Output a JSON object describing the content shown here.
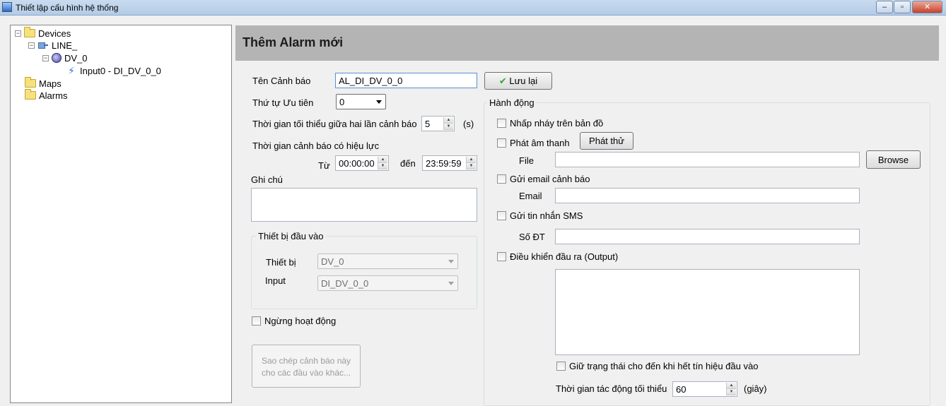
{
  "window": {
    "title": "Thiết lập cấu hình hệ thống",
    "minimize_glyph": "–",
    "maximize_glyph": "▫",
    "close_glyph": "✕"
  },
  "tree": {
    "devices": "Devices",
    "line": "LINE_",
    "device": "DV_0",
    "input": "Input0 - DI_DV_0_0",
    "maps": "Maps",
    "alarms": "Alarms",
    "expander_minus": "−"
  },
  "header": {
    "title": "Thêm Alarm mới"
  },
  "form": {
    "alarm_name_label": "Tên Cảnh báo",
    "alarm_name_value": "AL_DI_DV_0_0",
    "save_button": "Lưu lại",
    "priority_label": "Thứ tự Ưu tiên",
    "priority_value": "0",
    "min_interval_label": "Thời gian tối thiểu giữa hai lần cảnh báo",
    "min_interval_value": "5",
    "min_interval_unit": "(s)",
    "valid_time_label": "Thời gian cảnh báo có hiệu lực",
    "from_label": "Từ",
    "from_value": "00:00:00",
    "to_label": "đến",
    "to_value": "23:59:59",
    "note_label": "Ghi chú",
    "input_group_title": "Thiết bị đầu vào",
    "device_label": "Thiết bị",
    "device_value": "DV_0",
    "input_label": "Input",
    "input_value": "DI_DV_0_0",
    "disable_label": "Ngừng hoạt động",
    "copy_button_line1": "Sao chép cảnh báo này",
    "copy_button_line2": "cho các đầu vào khác..."
  },
  "actions": {
    "group_title": "Hành động",
    "blink_label": "Nhấp nháy trên bản đồ",
    "sound_label": "Phát âm thanh",
    "play_button": "Phát thử",
    "file_label": "File",
    "file_value": "",
    "browse_button": "Browse",
    "email_check_label": "Gửi email cảnh báo",
    "email_label": "Email",
    "email_value": "",
    "sms_check_label": "Gửi tin nhắn SMS",
    "phone_label": "Số ĐT",
    "phone_value": "",
    "output_label": "Điều khiển đầu ra (Output)",
    "hold_label": "Giữ trạng thái cho đến khi hết tín hiệu đầu vào",
    "min_action_label": "Thời gian tác động tối thiểu",
    "min_action_value": "60",
    "min_action_unit": "(giây)"
  },
  "icons": {
    "spin_up": "▲",
    "spin_down": "▼",
    "check_mark": "✔"
  },
  "colors": {
    "header_bg": "#b4b4b4",
    "titlebar_bg": "#c9dbef",
    "save_check": "#3aa336"
  }
}
